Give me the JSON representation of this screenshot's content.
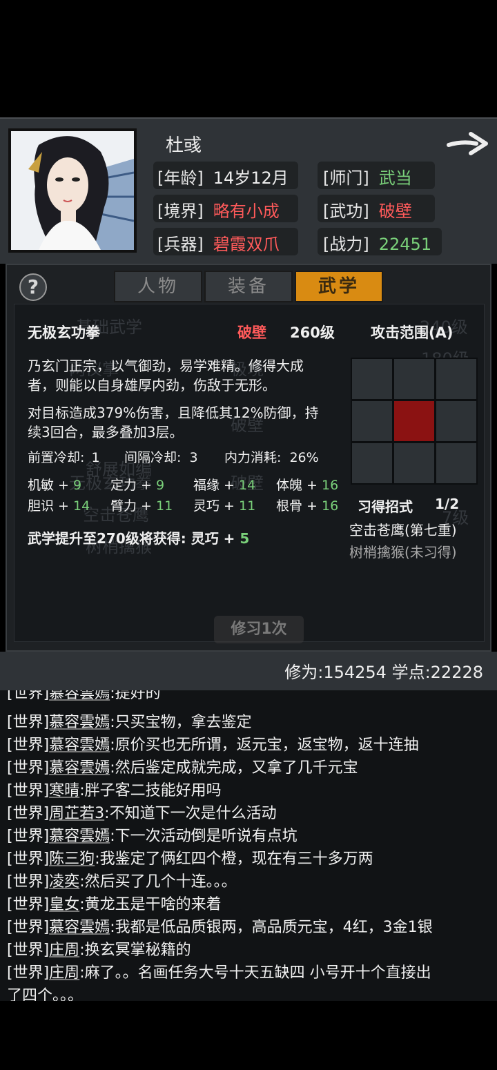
{
  "character": {
    "name": "杜彧",
    "age_label": "[年龄]",
    "age_value": "14岁12月",
    "sect_label": "[师门]",
    "sect_value": "武当",
    "realm_label": "[境界]",
    "realm_value": "略有小成",
    "martial_label": "[武功]",
    "martial_value": "破壁",
    "weapon_label": "[兵器]",
    "weapon_value": "碧霞双爪",
    "power_label": "[战力]",
    "power_value": "22451"
  },
  "tabs": [
    "人物",
    "装备",
    "武学"
  ],
  "active_tab": "武学",
  "skill": {
    "name": "无极玄功拳",
    "realm": "破壁",
    "level": "260级",
    "range_title": "攻击范围(A)",
    "desc1_line1": "乃玄门正宗，以气御劲，易学难精。修得大成",
    "desc1_line2": "者，则能以自身雄厚内劲，伤敌于无形。",
    "desc2_line1": "对目标造成379%伤害，且降低其12%防御，持",
    "desc2_line2": "续3回合，最多叠加3层。",
    "cooldown_pre_label": "前置冷却:",
    "cooldown_pre_value": "1",
    "cooldown_int_label": "间隔冷却:",
    "cooldown_int_value": "3",
    "mp_label": "内力消耗:",
    "mp_value": "26%",
    "attrs": [
      {
        "name": "机敏",
        "value": "9"
      },
      {
        "name": "定力",
        "value": "9"
      },
      {
        "name": "福缘",
        "value": "14"
      },
      {
        "name": "体魄",
        "value": "16"
      },
      {
        "name": "胆识",
        "value": "14"
      },
      {
        "name": "臂力",
        "value": "11"
      },
      {
        "name": "灵巧",
        "value": "11"
      },
      {
        "name": "根骨",
        "value": "16"
      }
    ],
    "upgrade_text": "武学提升至270级将获得: 灵巧 + ",
    "upgrade_value": "5",
    "moves_label": "习得招式",
    "moves_count": "1/2",
    "move1": "空击苍鹰(第七重)",
    "move2": "树梢擒猴(未习得)",
    "practice_button": "修习1次"
  },
  "ghost_text": [
    "基础武学",
    "240级",
    "180级",
    "两仪掌",
    "极境",
    "破壁",
    "舒展如编",
    "无极玄功拳",
    "破壁",
    "空击苍鹰",
    "7级",
    "树梢擒猴"
  ],
  "footer": {
    "text": "修为:154254  学点:22228"
  },
  "chat": [
    {
      "tag": "[世界]",
      "who": "慕容雲嫣",
      "msg": ":提好的"
    },
    {
      "tag": "[世界]",
      "who": "慕容雲嫣",
      "msg": ":只买宝物，拿去鉴定"
    },
    {
      "tag": "[世界]",
      "who": "慕容雲嫣",
      "msg": ":原价买也无所谓，返元宝，返宝物，返十连抽"
    },
    {
      "tag": "[世界]",
      "who": "慕容雲嫣",
      "msg": ":然后鉴定成就完成，又拿了几千元宝"
    },
    {
      "tag": "[世界]",
      "who": "寒晴",
      "msg": ":胖子客二技能好用吗"
    },
    {
      "tag": "[世界]",
      "who": "周芷若3",
      "msg": ":不知道下一次是什么活动"
    },
    {
      "tag": "[世界]",
      "who": "慕容雲嫣",
      "msg": ":下一次活动倒是听说有点坑"
    },
    {
      "tag": "[世界]",
      "who": "陈三狗",
      "msg": ":我鉴定了俩红四个橙，现在有三十多万两"
    },
    {
      "tag": "[世界]",
      "who": "凌奕",
      "msg": ":然后买了几个十连。。。"
    },
    {
      "tag": "[世界]",
      "who": "皇女",
      "msg": ":黄龙玉是干啥的来着"
    },
    {
      "tag": "[世界]",
      "who": "慕容雲嫣",
      "msg": ":我都是低品质银两，高品质元宝，4红，3金1银"
    },
    {
      "tag": "[世界]",
      "who": "庄周",
      "msg": ":换玄冥掌秘籍的"
    },
    {
      "tag": "[世界]",
      "who": "庄周",
      "msg": ":麻了。。名画任务大号十天五缺四 小号开十个直接出"
    },
    {
      "tag": "",
      "who": "",
      "msg": "了四个。。。"
    }
  ],
  "colors": {
    "accent_orange": "#d98b12",
    "value_red": "#ff5a5a",
    "value_green": "#7ad07a",
    "hit_cell": "#8b1212"
  }
}
